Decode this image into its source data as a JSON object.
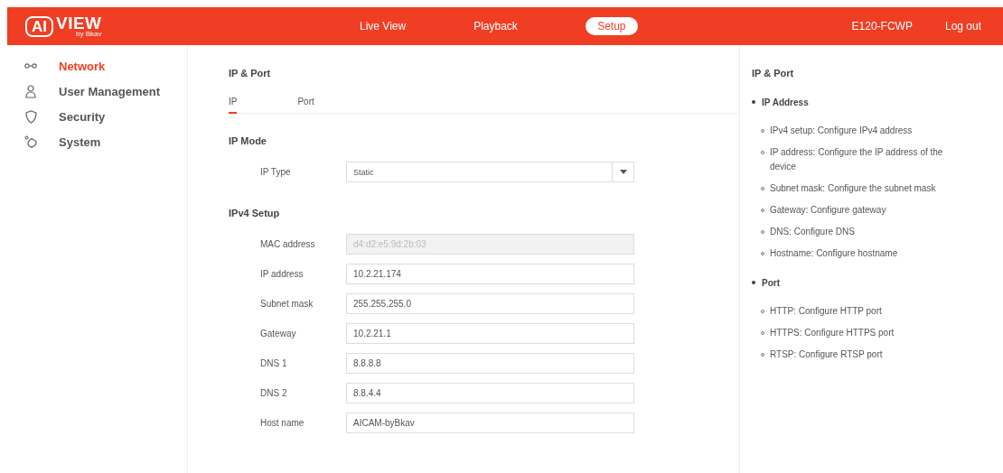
{
  "logo": {
    "mark": "AI",
    "word": "VIEW",
    "tagline": "by Bkav"
  },
  "nav": [
    {
      "label": "Live View",
      "selected": false
    },
    {
      "label": "Playback",
      "selected": false
    },
    {
      "label": "Setup",
      "selected": true
    }
  ],
  "device": "E120-FCWP",
  "logout": "Log out",
  "sidebar": {
    "items": [
      {
        "label": "Network",
        "kind": "network",
        "selected": true
      },
      {
        "label": "User Management",
        "kind": "user",
        "selected": false
      },
      {
        "label": "Security",
        "kind": "shield",
        "selected": false
      },
      {
        "label": "System",
        "kind": "system",
        "selected": false
      }
    ]
  },
  "title": "IP & Port",
  "tabs": [
    {
      "label": "IP",
      "selected": true
    },
    {
      "label": "Port",
      "selected": false
    }
  ],
  "ip_mode": {
    "heading": "IP Mode",
    "label": "IP Type",
    "value": "Static"
  },
  "ipv4": {
    "heading": "IPv4 Setup",
    "fields": [
      {
        "label": "MAC address",
        "value": "d4:d2:e5:9d:2b:03",
        "disabled": true
      },
      {
        "label": "IP address",
        "value": "10.2.21.174",
        "disabled": false
      },
      {
        "label": "Subnet mask",
        "value": "255.255.255.0",
        "disabled": false
      },
      {
        "label": "Gateway",
        "value": "10.2.21.1",
        "disabled": false
      },
      {
        "label": "DNS 1",
        "value": "8.8.8.8",
        "disabled": false
      },
      {
        "label": "DNS 2",
        "value": "8.8.4.4",
        "disabled": false
      },
      {
        "label": "Host name",
        "value": "AICAM-byBkav",
        "disabled": false
      }
    ]
  },
  "help": {
    "title": "IP & Port",
    "sections": [
      {
        "heading": "IP Address",
        "items": [
          "IPv4 setup: Configure IPv4 address",
          "IP address: Configure the IP address of the device",
          "Subnet mask: Configure the subnet mask",
          "Gateway: Configure gateway",
          "DNS: Configure DNS",
          "Hostname: Configure hostname"
        ]
      },
      {
        "heading": "Port",
        "items": [
          "HTTP: Configure HTTP port",
          "HTTPS: Configure HTTPS port",
          "RTSP: Configure RTSP port"
        ]
      }
    ]
  }
}
